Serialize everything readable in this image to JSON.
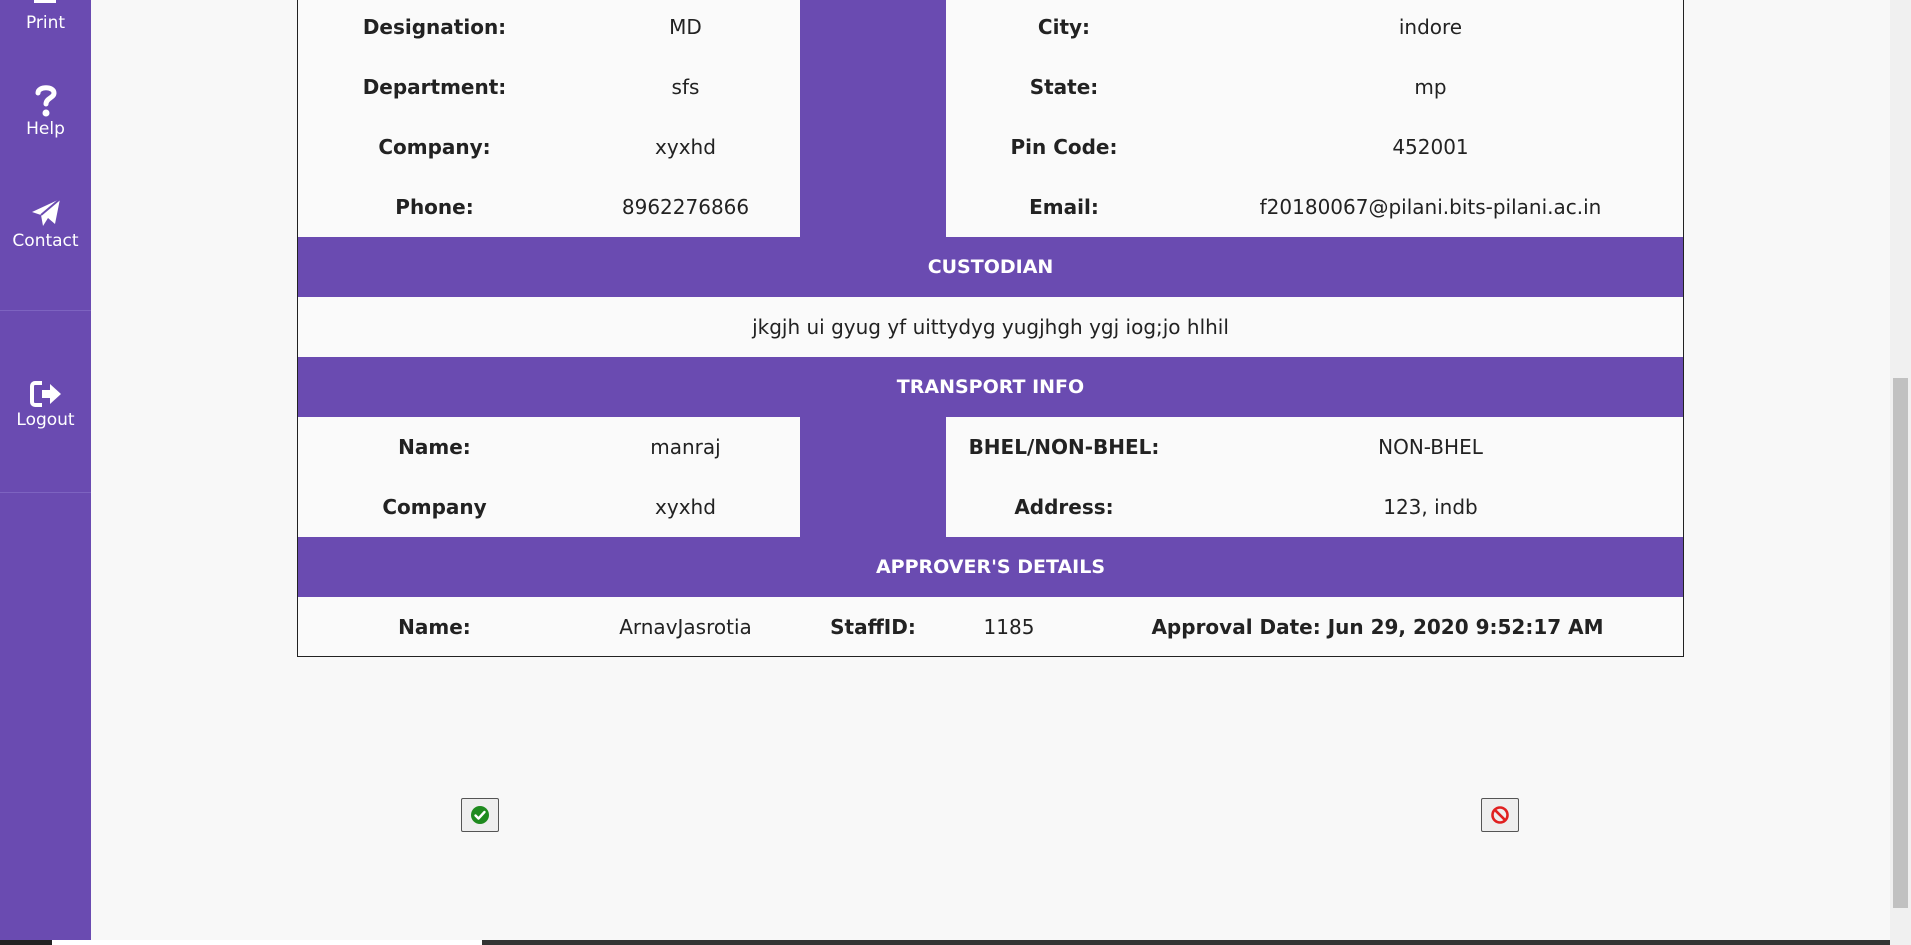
{
  "sidebar": {
    "items": [
      {
        "label": "Print",
        "icon": "print-icon"
      },
      {
        "label": "Help",
        "icon": "question-icon"
      },
      {
        "label": "Contact",
        "icon": "paper-plane-icon"
      },
      {
        "label": "Logout",
        "icon": "sign-out-icon"
      }
    ]
  },
  "employee": {
    "left": [
      {
        "label": "Designation:",
        "value": "MD"
      },
      {
        "label": "Department:",
        "value": "sfs"
      },
      {
        "label": "Company:",
        "value": "xyxhd"
      },
      {
        "label": "Phone:",
        "value": "8962276866"
      }
    ],
    "right": [
      {
        "label": "City:",
        "value": "indore"
      },
      {
        "label": "State:",
        "value": "mp"
      },
      {
        "label": "Pin Code:",
        "value": "452001"
      },
      {
        "label": "Email:",
        "value": "f20180067@pilani.bits-pilani.ac.in"
      }
    ]
  },
  "custodian": {
    "title": "CUSTODIAN",
    "text": "jkgjh ui gyug yf uittydyg yugjhgh ygj iog;jo hlhil"
  },
  "transport": {
    "title": "TRANSPORT INFO",
    "left": [
      {
        "label": "Name:",
        "value": "manraj"
      },
      {
        "label": "Company",
        "value": "xyxhd"
      }
    ],
    "right": [
      {
        "label": "BHEL/NON-BHEL:",
        "value": "NON-BHEL"
      },
      {
        "label": "Address:",
        "value": "123, indb"
      }
    ]
  },
  "approver": {
    "title": "APPROVER'S DETAILS",
    "name_label": "Name:",
    "name_value": "ArnavJasrotia",
    "staff_label": "StaffID:",
    "staff_value": "1185",
    "approval_text": "Approval Date: Jun 29, 2020 9:52:17 AM"
  },
  "actions": {
    "approve_icon": "check-circle-icon",
    "reject_icon": "ban-icon"
  },
  "colors": {
    "accent": "#6a4bb1",
    "approve": "#1e8a1e",
    "reject": "#e02020"
  }
}
